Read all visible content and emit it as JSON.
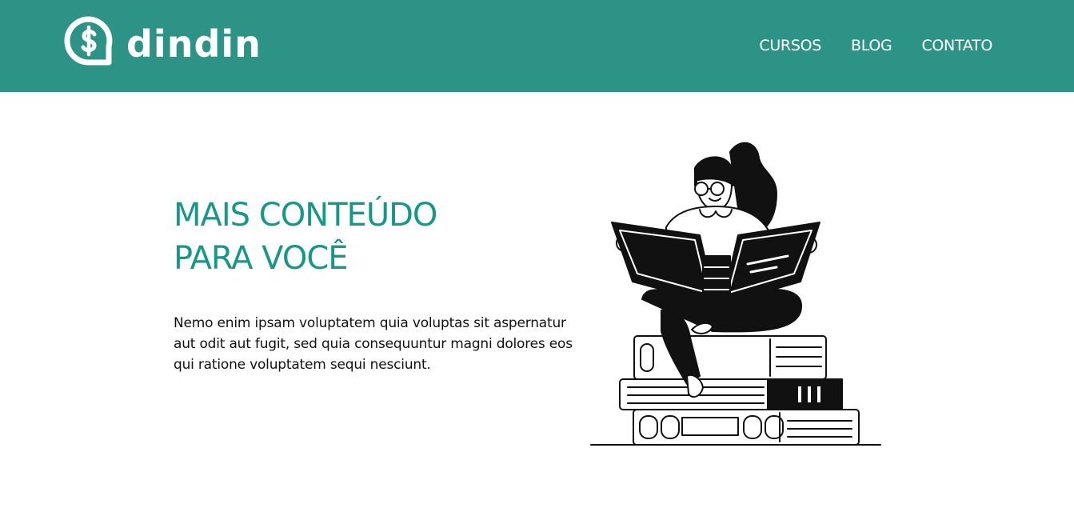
{
  "brand": {
    "name": "dindin",
    "logo_icon": "dollar-speech-bubble-icon"
  },
  "nav": {
    "items": [
      "CURSOS",
      "BLOG",
      "CONTATO"
    ]
  },
  "hero": {
    "title_line1": "MAIS CONTEÚDO",
    "title_line2": "PARA VOCÊ",
    "body": "Nemo enim ipsam voluptatem quia voluptas sit aspernatur aut odit aut fugit, sed quia consequuntur magni dolores eos qui ratione voluptatem sequi nesciunt."
  },
  "colors": {
    "header": "#2e9387",
    "title": "#17978a",
    "text": "#111111"
  }
}
